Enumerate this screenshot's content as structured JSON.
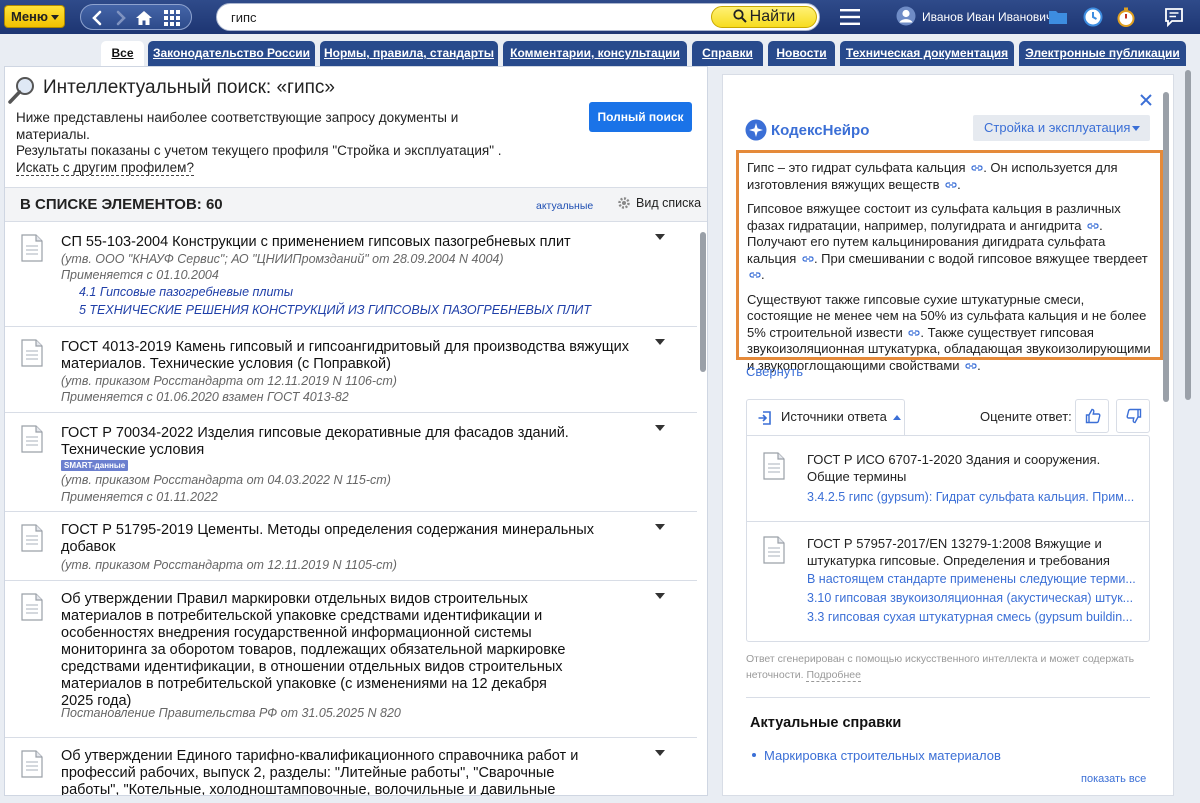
{
  "topbar": {
    "menu_label": "Меню",
    "search_value": "гипс",
    "find_label": "Найти",
    "user_name": "Иванов Иван Иванович"
  },
  "tabs": [
    {
      "label": "Все",
      "active": true
    },
    {
      "label": "Законодательство России"
    },
    {
      "label": "Нормы, правила, стандарты"
    },
    {
      "label": "Комментарии, консультации"
    },
    {
      "label": "Справки"
    },
    {
      "label": "Новости"
    },
    {
      "label": "Техническая документация"
    },
    {
      "label": "Электронные публикации"
    }
  ],
  "left": {
    "search_title": "Интеллектуальный поиск: «гипс»",
    "intro_line1": "Ниже представлены наиболее соответствующие запросу документы и материалы.",
    "intro_line2": "Результаты показаны с учетом текущего профиля \"Стройка и эксплуатация\" .",
    "change_profile": "Искать с другим профилем?",
    "full_search_btn": "Полный поиск",
    "list_count": "В СПИСКЕ ЭЛЕМЕНТОВ: 60",
    "actual_filter": "актуальные",
    "view_list": "Вид списка",
    "docs": [
      {
        "title": "СП 55-103-2004 Конструкции с применением гипсовых пазогребневых плит",
        "approval": "(утв. ООО \"КНАУФ Сервис\"; АО \"ЦНИИПромзданий\" от 28.09.2004 N 4004)",
        "status": "Применяется с 01.10.2004",
        "links": [
          "4.1 Гипсовые пазогребневые плиты",
          "5 ТЕХНИЧЕСКИЕ РЕШЕНИЯ КОНСТРУКЦИЙ ИЗ ГИПСОВЫХ ПАЗОГРЕБНЕВЫХ ПЛИТ"
        ]
      },
      {
        "title": "ГОСТ 4013-2019 Камень гипсовый и гипсоангидритовый для производства вяжущих материалов. Технические условия (с Поправкой)",
        "approval": "(утв. приказом Росстандарта от 12.11.2019 N 1106-ст)",
        "status": "Применяется с 01.06.2020 взамен ГОСТ 4013-82"
      },
      {
        "title": "ГОСТ Р 70034-2022 Изделия гипсовые декоративные для фасадов зданий. Технические условия",
        "badge": "SMART-данные",
        "approval": "(утв. приказом Росстандарта от 04.03.2022 N 115-ст)",
        "status": "Применяется с 01.11.2022"
      },
      {
        "title": "ГОСТ Р 51795-2019 Цементы. Методы определения содержания минеральных добавок",
        "approval": "(утв. приказом Росстандарта от 12.11.2019 N 1105-ст)"
      },
      {
        "title": "Об утверждении Правил маркировки отдельных видов строительных материалов в потребительской упаковке средствами идентификации и особенностях внедрения государственной информационной системы мониторинга за оборотом товаров, подлежащих обязательной маркировке средствами идентификации, в отношении отдельных видов строительных материалов в потребительской упаковке (с изменениями на 12 декабря 2025 года)",
        "approval": "Постановление Правительства РФ от 31.05.2025 N 820"
      },
      {
        "title": "Об утверждении Единого тарифно-квалификационного справочника работ и профессий рабочих, выпуск 2, разделы: \"Литейные работы\", \"Сварочные работы\", \"Котельные, холодноштамповочные, волочильные и давильные работы\", \"Кузнечно-прессовые и термические работы\", \"Механическая обработка\""
      }
    ]
  },
  "right": {
    "brand": "КодексНейро",
    "profile": "Стройка и эксплуатация",
    "answer_p1": "Гипс – это гидрат сульфата кальция . Он используется для изготовления вяжущих веществ .",
    "answer_p2": "Гипсовое вяжущее состоит из сульфата кальция в различных фазах гидратации, например, полугидрата и ангидрита . Получают его путем кальцинирования дигидрата сульфата кальция . При смешивании с водой гипсовое вяжущее твердеет .",
    "answer_p3": "Существуют также гипсовые сухие штукатурные смеси, состоящие не менее чем на 50% из сульфата кальция и не более 5% строительной извести . Также существует гипсовая звукоизоляционная штукатурка, обладающая звукоизолирующими и звукопоглощающими свойствами .",
    "collapse": "Свернуть",
    "sources_label": "Источники ответа",
    "rate_label": "Оцените ответ:",
    "sources": [
      {
        "title": "ГОСТ Р ИСО 6707-1-2020 Здания и сооружения. Общие термины",
        "links": [
          "3.4.2.5 гипс (gypsum): Гидрат сульфата кальция. Прим..."
        ]
      },
      {
        "title": "ГОСТ Р 57957-2017/EN 13279-1:2008 Вяжущие и штукатурка гипсовые. Определения и требования",
        "links": [
          "В настоящем стандарте применены следующие терми...",
          "3.10 гипсовая звукоизоляционная (акустическая) штук...",
          "3.3 гипсовая сухая штукатурная смесь (gypsum buildin..."
        ]
      }
    ],
    "disclaimer": "Ответ сгенерирован с помощью искусственного интеллекта и может содержать неточности.",
    "more": "Подробнее",
    "refs_title": "Актуальные справки",
    "ref_item": "Маркировка строительных материалов",
    "show_all": "показать все"
  },
  "colors": {
    "topbar": "#1d3572",
    "tab": "#284a8c",
    "accent_yellow": "#f7dc1f",
    "link_blue": "#3b6fd6",
    "highlight_border": "#e58a3a",
    "primary_button": "#1a73e8"
  }
}
